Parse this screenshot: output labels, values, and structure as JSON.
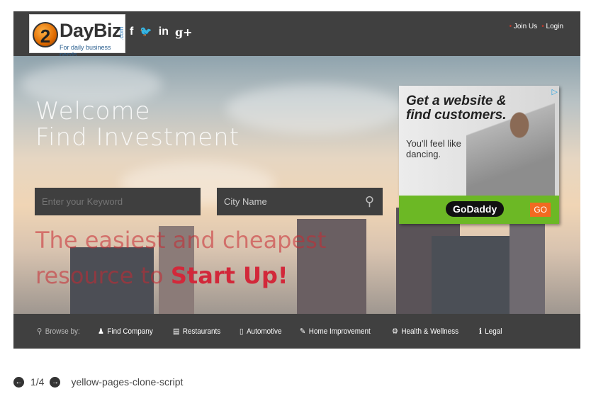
{
  "header": {
    "logo_number": "2",
    "logo_name": "DayBiz",
    "logo_tld": ".com",
    "logo_tagline": "For daily business needs",
    "social": [
      {
        "icon": "facebook-icon",
        "glyph": "f"
      },
      {
        "icon": "twitter-icon",
        "glyph": "🐦"
      },
      {
        "icon": "linkedin-icon",
        "glyph": "in"
      },
      {
        "icon": "google-plus-icon",
        "glyph": "g+"
      }
    ],
    "join_label": "Join Us",
    "login_label": "Login"
  },
  "hero": {
    "welcome": "Welcome",
    "subtitle": "Find Investment",
    "keyword_placeholder": "Enter your Keyword",
    "city_placeholder": "City Name",
    "tagline_line1": "The easiest and cheapest",
    "tagline_line2_prefix": "resource to ",
    "tagline_highlight": "Start Up!"
  },
  "ad": {
    "headline": "Get a website & find customers.",
    "subline": "You'll feel like dancing.",
    "brand": "GoDaddy",
    "cta": "GO"
  },
  "nav": {
    "browse_label": "Browse by:",
    "items": [
      {
        "label": "Find Company",
        "icon": "user-icon",
        "glyph": "👤"
      },
      {
        "label": "Restaurants",
        "icon": "list-icon",
        "glyph": "▤"
      },
      {
        "label": "Automotive",
        "icon": "mobile-icon",
        "glyph": "▯"
      },
      {
        "label": "Home Improvement",
        "icon": "edit-icon",
        "glyph": "✎"
      },
      {
        "label": "Health & Wellness",
        "icon": "gear-icon",
        "glyph": "✿"
      },
      {
        "label": "Legal",
        "icon": "info-icon",
        "glyph": "ℹ"
      }
    ]
  },
  "pager": {
    "position": "1/4",
    "caption": "yellow-pages-clone-script"
  }
}
